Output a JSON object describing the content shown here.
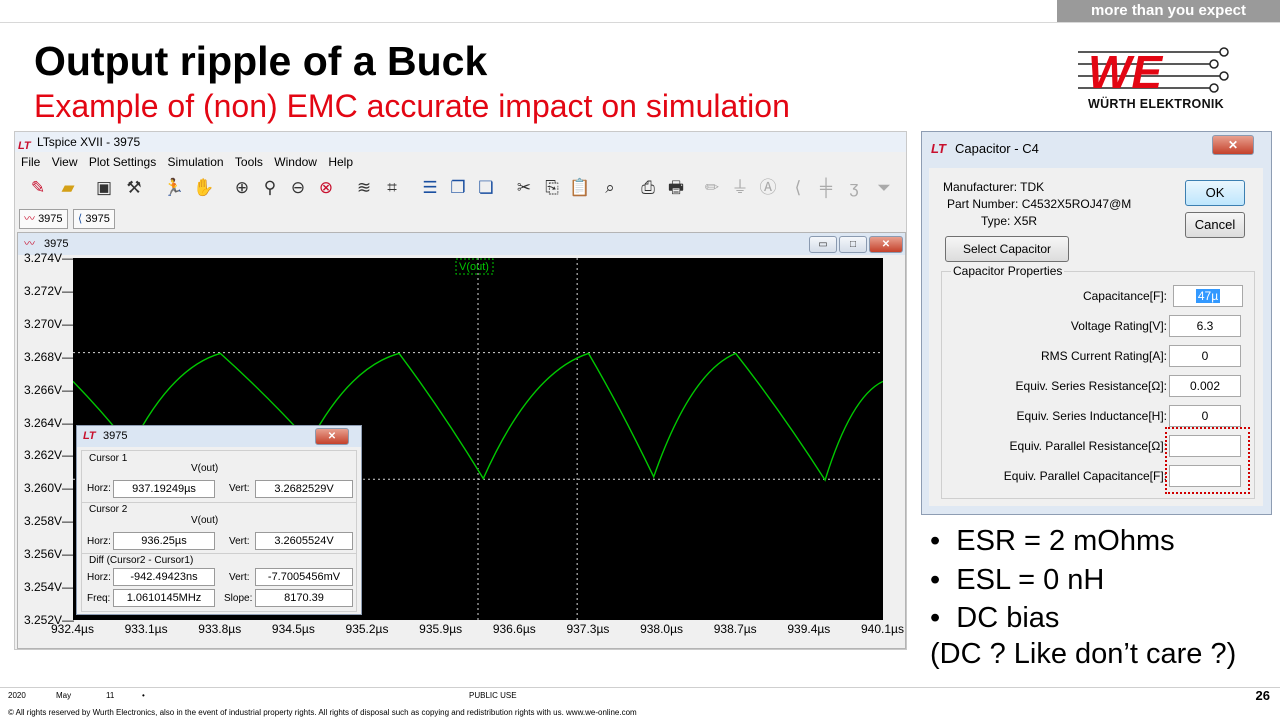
{
  "header": {
    "tagline": "more than you expect",
    "title": "Output ripple of a Buck",
    "subtitle": "Example of (non) EMC accurate impact on simulation",
    "logo_text": "WÜRTH ELEKTRONIK"
  },
  "ltspice": {
    "window_title": "LTspice XVII - 3975",
    "menu": [
      "File",
      "View",
      "Plot Settings",
      "Simulation",
      "Tools",
      "Window",
      "Help"
    ],
    "tabs": [
      "3975",
      "3975"
    ],
    "plot_window_title": "3975",
    "trace_label": "V(out)",
    "trace_color": "#00c800",
    "background_color": "#000000",
    "y_ticks": [
      "3.274V",
      "3.272V",
      "3.270V",
      "3.268V",
      "3.266V",
      "3.264V",
      "3.262V",
      "3.260V",
      "3.258V",
      "3.256V",
      "3.254V",
      "3.252V"
    ],
    "x_ticks": [
      "932.4µs",
      "933.1µs",
      "933.8µs",
      "934.5µs",
      "935.2µs",
      "935.9µs",
      "936.6µs",
      "937.3µs",
      "938.0µs",
      "938.7µs",
      "939.4µs",
      "940.1µs"
    ]
  },
  "chart_data": {
    "type": "line",
    "title": "V(out)",
    "xlabel": "",
    "ylabel": "",
    "xlim": [
      932.4,
      940.1
    ],
    "ylim": [
      3.252,
      3.274
    ],
    "grid": false,
    "series": [
      {
        "name": "V(out)",
        "x": [
          932.4,
          932.95,
          933.8,
          934.65,
          935.5,
          936.3,
          937.3,
          937.92,
          938.7,
          939.55,
          940.1
        ],
        "y": [
          3.2665,
          3.2625,
          3.2682,
          3.2628,
          3.2682,
          3.2606,
          3.2682,
          3.2607,
          3.2682,
          3.2605,
          3.2665
        ]
      }
    ],
    "cursor_x": [
      936.25,
      937.19249
    ],
    "cursor_y": [
      3.2605524,
      3.2682529
    ]
  },
  "cursor_dialog": {
    "title": "3975",
    "cursor1_label": "Cursor 1",
    "cursor1_trace": "V(out)",
    "horz_label": "Horz:",
    "vert_label": "Vert:",
    "cursor1_horz": "937.19249µs",
    "cursor1_vert": "3.2682529V",
    "cursor2_label": "Cursor 2",
    "cursor2_trace": "V(out)",
    "cursor2_horz": "936.25µs",
    "cursor2_vert": "3.2605524V",
    "diff_label": "Diff (Cursor2 - Cursor1)",
    "diff_horz": "-942.49423ns",
    "diff_vert": "-7.7005456mV",
    "freq_label": "Freq:",
    "freq": "1.0610145MHz",
    "slope_label": "Slope:",
    "slope": "8170.39"
  },
  "capacitor_dialog": {
    "title": "Capacitor - C4",
    "manufacturer": "Manufacturer: TDK",
    "part_number": "Part Number: C4532X5ROJ47@M",
    "type": "Type: X5R",
    "ok": "OK",
    "cancel": "Cancel",
    "select_button": "Select Capacitor",
    "group_label": "Capacitor Properties",
    "fields": [
      {
        "label": "Capacitance[F]:",
        "value": "47µ"
      },
      {
        "label": "Voltage Rating[V]:",
        "value": "6.3"
      },
      {
        "label": "RMS Current Rating[A]:",
        "value": "0"
      },
      {
        "label": "Equiv. Series Resistance[Ω]:",
        "value": "0.002"
      },
      {
        "label": "Equiv. Series Inductance[H]:",
        "value": "0"
      },
      {
        "label": "Equiv. Parallel Resistance[Ω]:",
        "value": ""
      },
      {
        "label": "Equiv. Parallel Capacitance[F]:",
        "value": ""
      }
    ]
  },
  "bullets": [
    "ESR = 2 mOhms",
    "ESL = 0 nH",
    "DC bias"
  ],
  "note": "(DC ? Like don’t care ?)",
  "footer": {
    "year": "2020",
    "month": "May",
    "day": "11",
    "dot": "•",
    "classification": "PUBLIC USE",
    "page": "26",
    "copyright": "© All rights reserved by Wurth Electronics, also in the event of industrial property rights. All rights of disposal such as copying and redistribution rights with us. www.we-online.com"
  }
}
